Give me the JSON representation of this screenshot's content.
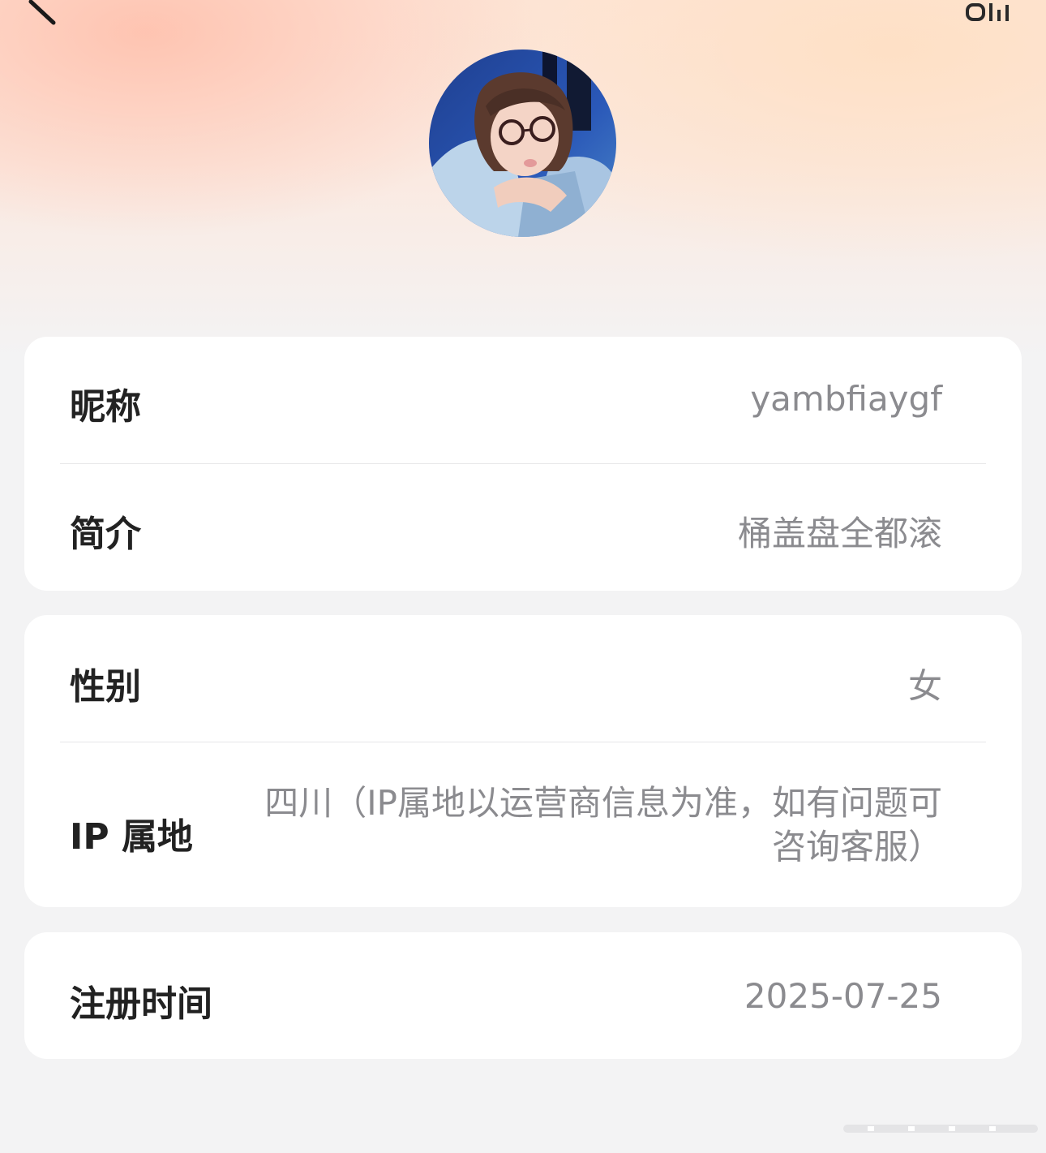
{
  "header": {
    "back_icon": "chevron-left-icon",
    "corner_mark": "Oll"
  },
  "avatar": {
    "icon": "user-avatar-photo"
  },
  "basic_info": {
    "nickname": {
      "label": "昵称",
      "value": "yambfiaygf"
    },
    "bio": {
      "label": "简介",
      "value": "桶盖盘全都滚"
    }
  },
  "details": {
    "gender": {
      "label": "性别",
      "value": "女"
    },
    "ip_location": {
      "label": "IP 属地",
      "value": "四川（IP属地以运营商信息为准，如有问题可咨询客服）"
    }
  },
  "registration": {
    "label": "注册时间",
    "value": "2025-07-25"
  },
  "colors": {
    "label_text": "#222222",
    "value_text": "#8b8b8f",
    "card_bg": "#ffffff",
    "page_bg": "#f3f3f4"
  }
}
